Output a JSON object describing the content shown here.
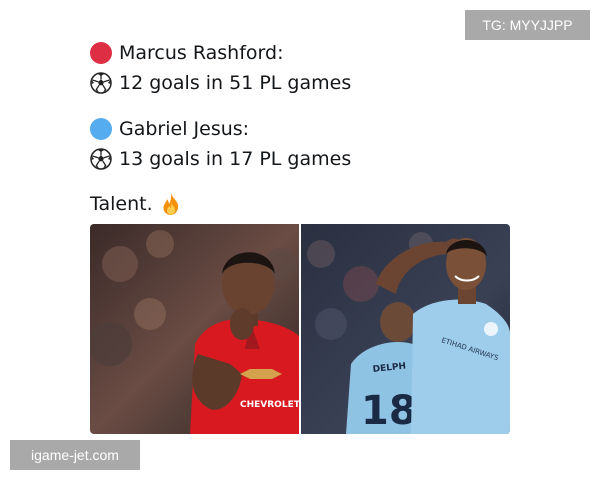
{
  "watermarks": {
    "top_right": "TG: MYYJJPP",
    "bottom_left": "igame-jet.com"
  },
  "tweet": {
    "players": [
      {
        "name": "Marcus Rashford:",
        "stat": "12 goals in 51 PL games",
        "dot_color": "#dd2e44"
      },
      {
        "name": "Gabriel Jesus:",
        "stat": "13 goals in 17 PL games",
        "dot_color": "#55acee"
      }
    ],
    "caption": "Talent.",
    "icons": {
      "player_marker": "circle",
      "stat_icon": "soccer-ball-icon",
      "caption_icon": "fire-icon"
    }
  },
  "media": {
    "left_photo": {
      "subject": "rashford-photo",
      "shirt_sponsor": "CHEVROLET"
    },
    "right_photo": {
      "subject": "jesus-photo",
      "back_name": "DELPH",
      "back_number": "18",
      "shirt_sponsor": "ETIHAD AIRWAYS"
    }
  }
}
